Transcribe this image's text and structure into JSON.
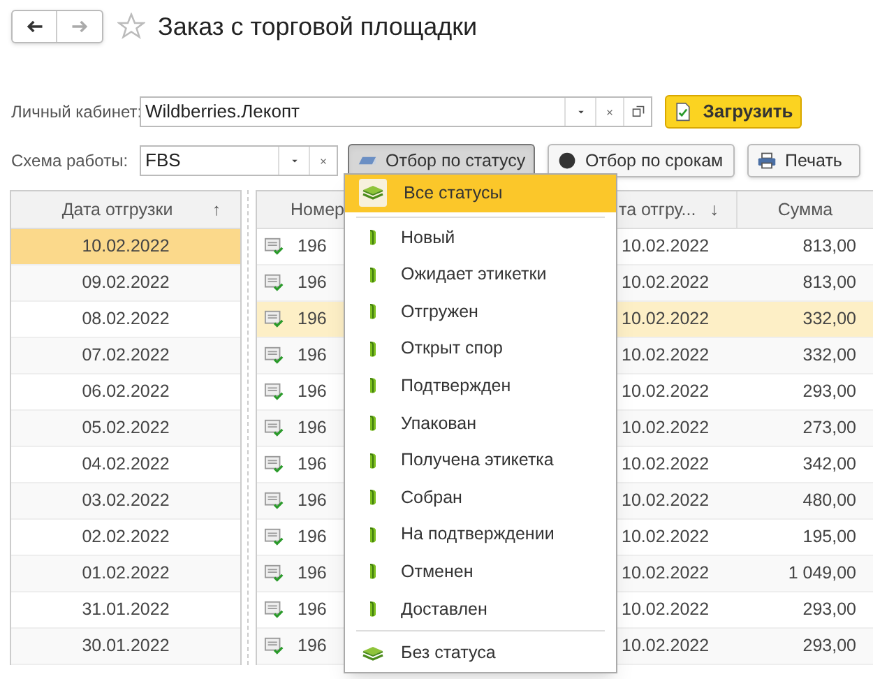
{
  "window": {
    "title": "Заказ с торговой площадки"
  },
  "form": {
    "account": {
      "label": "Личный кабинет:",
      "value": "Wildberries.Лекопт"
    },
    "load_button": "Загрузить",
    "scheme": {
      "label": "Схема работы:",
      "value": "FBS"
    }
  },
  "filters": [
    {
      "label": "Отбор по статусу",
      "kind": "status",
      "pressed": true
    },
    {
      "label": "Отбор по срокам",
      "kind": "deadline",
      "pressed": false
    },
    {
      "label": "Печать",
      "kind": "print",
      "pressed": false
    }
  ],
  "dates_table": {
    "header": "Дата отгрузки",
    "sort_mark": "↑",
    "rows": [
      {
        "date": "10.02.2022",
        "selected": true
      },
      {
        "date": "09.02.2022",
        "selected": false
      },
      {
        "date": "08.02.2022",
        "selected": false
      },
      {
        "date": "07.02.2022",
        "selected": false
      },
      {
        "date": "06.02.2022",
        "selected": false
      },
      {
        "date": "05.02.2022",
        "selected": false
      },
      {
        "date": "04.02.2022",
        "selected": false
      },
      {
        "date": "03.02.2022",
        "selected": false
      },
      {
        "date": "02.02.2022",
        "selected": false
      },
      {
        "date": "01.02.2022",
        "selected": false
      },
      {
        "date": "31.01.2022",
        "selected": false
      },
      {
        "date": "30.01.2022",
        "selected": false
      }
    ]
  },
  "orders_table": {
    "columns": [
      {
        "label": "Номер"
      },
      {
        "label": "та отгру...",
        "sort_mark": "↓"
      },
      {
        "label": "Сумма"
      }
    ],
    "rows": [
      {
        "number": "196",
        "date": "10.02.2022",
        "sum": "813,00",
        "selected": false
      },
      {
        "number": "196",
        "date": "10.02.2022",
        "sum": "813,00",
        "selected": false
      },
      {
        "number": "196",
        "date": "10.02.2022",
        "sum": "332,00",
        "selected": true
      },
      {
        "number": "196",
        "date": "10.02.2022",
        "sum": "332,00",
        "selected": false
      },
      {
        "number": "196",
        "date": "10.02.2022",
        "sum": "293,00",
        "selected": false
      },
      {
        "number": "196",
        "date": "10.02.2022",
        "sum": "273,00",
        "selected": false
      },
      {
        "number": "196",
        "date": "10.02.2022",
        "sum": "342,00",
        "selected": false
      },
      {
        "number": "196",
        "date": "10.02.2022",
        "sum": "480,00",
        "selected": false
      },
      {
        "number": "196",
        "date": "10.02.2022",
        "sum": "195,00",
        "selected": false
      },
      {
        "number": "196",
        "date": "10.02.2022",
        "sum": "1 049,00",
        "selected": false
      },
      {
        "number": "196",
        "date": "10.02.2022",
        "sum": "293,00",
        "selected": false
      },
      {
        "number": "196",
        "date": "10.02.2022",
        "sum": "293,00",
        "selected": false
      }
    ]
  },
  "status_menu": {
    "items": [
      {
        "label": "Все статусы",
        "kind": "group",
        "selected": true
      },
      {
        "label": "Новый",
        "kind": "status",
        "selected": false
      },
      {
        "label": "Ожидает этикетки",
        "kind": "status",
        "selected": false
      },
      {
        "label": "Отгружен",
        "kind": "status",
        "selected": false
      },
      {
        "label": "Открыт спор",
        "kind": "status",
        "selected": false
      },
      {
        "label": "Подтвержден",
        "kind": "status",
        "selected": false
      },
      {
        "label": "Упакован",
        "kind": "status",
        "selected": false
      },
      {
        "label": "Получена этикетка",
        "kind": "status",
        "selected": false
      },
      {
        "label": "Собран",
        "kind": "status",
        "selected": false
      },
      {
        "label": "На подтверждении",
        "kind": "status",
        "selected": false
      },
      {
        "label": "Отменен",
        "kind": "status",
        "selected": false
      },
      {
        "label": "Доставлен",
        "kind": "status",
        "selected": false
      },
      {
        "label": "Без статуса",
        "kind": "group",
        "selected": false
      }
    ]
  }
}
